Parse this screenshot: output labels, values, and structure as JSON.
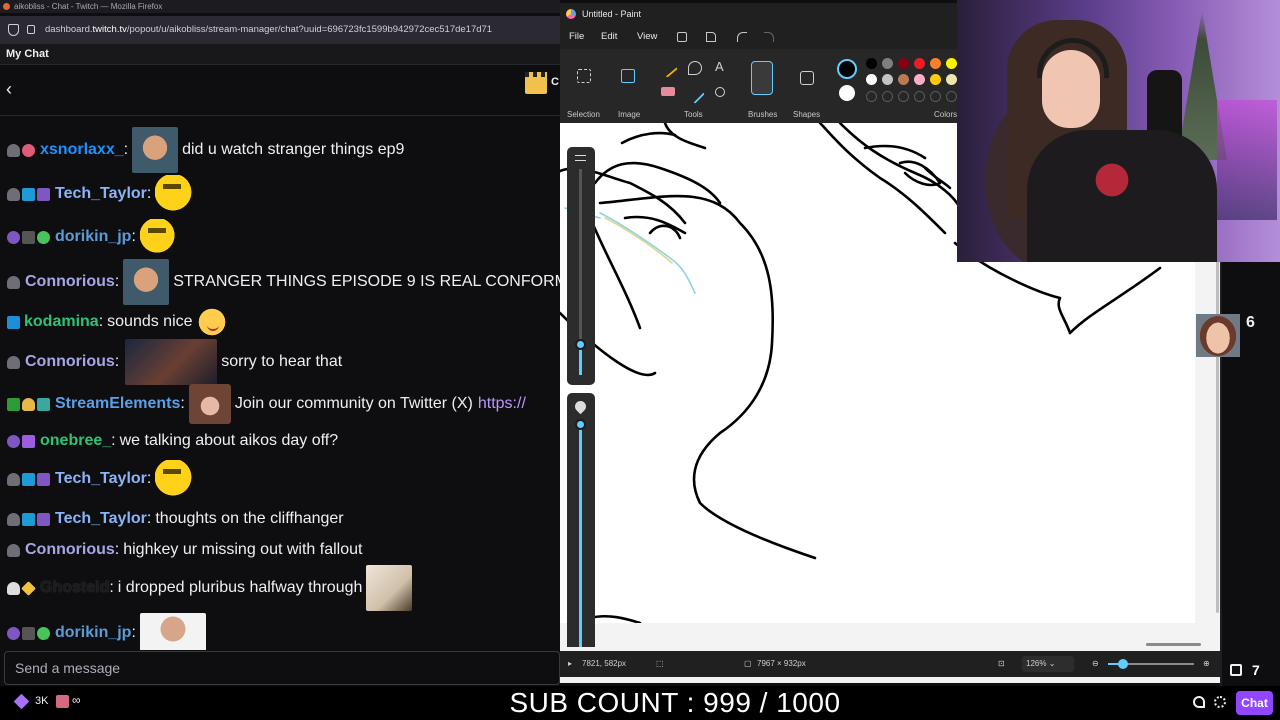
{
  "browser": {
    "title": "aikobliss - Chat - Twitch — Mozilla Firefox",
    "url_prefix": "dashboard.",
    "url_domain": "twitch.tv",
    "url_rest": "/popout/u/aikobliss/stream-manager/chat?uuid=696723fc1599b942972cec517de17d71"
  },
  "chat": {
    "header": "My Chat",
    "pinned_label": "C",
    "input_placeholder": "Send a message",
    "messages": [
      {
        "user": "xsnorlaxx_",
        "color": "#1e90ff",
        "text": "did u watch stranger things ep9"
      },
      {
        "user": "Tech_Taylor",
        "color": "#8ab4f8",
        "text": ""
      },
      {
        "user": "dorikin_jp",
        "color": "#5c9bd6",
        "text": ""
      },
      {
        "user": "Connorious",
        "color": "#a6a6e6",
        "text": "STRANGER THINGS EPISODE 9 IS REAL CONFORM"
      },
      {
        "user": "kodamina",
        "color": "#2ec275",
        "text": "sounds nice"
      },
      {
        "user": "Connorious",
        "color": "#a6a6e6",
        "text": "sorry to hear that"
      },
      {
        "user": "StreamElements",
        "color": "#5b9fe6",
        "text": "Join our community on Twitter (X)",
        "link": "https://"
      },
      {
        "user": "onebree_",
        "color": "#2ec275",
        "text": "we talking about aikos day off?"
      },
      {
        "user": "Tech_Taylor",
        "color": "#8ab4f8",
        "text": ""
      },
      {
        "user": "Tech_Taylor",
        "color": "#8ab4f8",
        "text": "thoughts on the cliffhanger"
      },
      {
        "user": "Connorious",
        "color": "#a6a6e6",
        "text": "highkey ur missing out with fallout"
      },
      {
        "user": "Ghosteld",
        "color": "#1a1a1a",
        "text": "i dropped pluribus halfway through"
      },
      {
        "user": "dorikin_jp",
        "color": "#5c9bd6",
        "text": ""
      }
    ]
  },
  "paint": {
    "title": "Untitled - Paint",
    "menu": {
      "file": "File",
      "edit": "Edit",
      "view": "View"
    },
    "groups": {
      "selection": "Selection",
      "image": "Image",
      "tools": "Tools",
      "brushes": "Brushes",
      "shapes": "Shapes",
      "colors": "Colors"
    },
    "tool_text": "A",
    "status": {
      "cursor": "7821, 582px",
      "size": "7967 × 932px",
      "zoom": "126%"
    },
    "zoom_level": 0.18,
    "palette": [
      "#000000",
      "#7f7f7f",
      "#880015",
      "#ed1c24",
      "#ff7f27",
      "#fff200",
      "#ffffff",
      "#c3c3c3",
      "#b97a57",
      "#ffaec9",
      "#ffc90e",
      "#efe4b0"
    ]
  },
  "overlay": {
    "sub_count": "SUB COUNT : 999 / 1000",
    "viewers": "3K",
    "infinity": "∞",
    "side_count": "6",
    "chat_button": "Chat"
  }
}
